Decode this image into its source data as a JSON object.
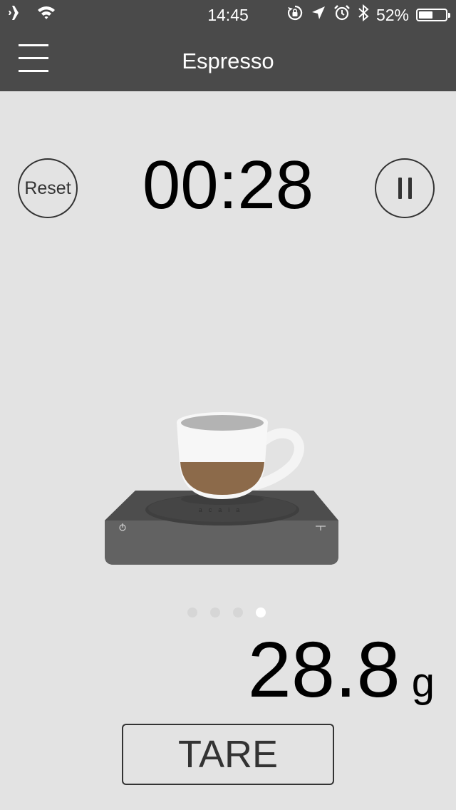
{
  "status_bar": {
    "time": "14:45",
    "battery_percent": "52%",
    "battery_level": 0.52,
    "left_icons": [
      "airplane-icon",
      "wifi-icon"
    ],
    "right_icons": [
      "rotation-lock-icon",
      "location-arrow-icon",
      "alarm-clock-icon",
      "bluetooth-icon",
      "battery-icon"
    ]
  },
  "header": {
    "title": "Espresso",
    "menu_icon": "hamburger-menu-icon"
  },
  "timer": {
    "value": "00:28",
    "reset_label": "Reset",
    "pause_icon": "pause-icon"
  },
  "illustration": {
    "scale_brand": "acaia",
    "coffee_color": "#8c6a4a",
    "scale_color": "#5a5a5a"
  },
  "pager": {
    "count": 4,
    "active_index": 3
  },
  "weight": {
    "value": "28.8",
    "unit": "g"
  },
  "tare": {
    "label": "TARE"
  },
  "colors": {
    "header_bg": "#4a4a4a",
    "page_bg": "#e3e3e3",
    "text": "#000000",
    "outline": "#333333"
  }
}
